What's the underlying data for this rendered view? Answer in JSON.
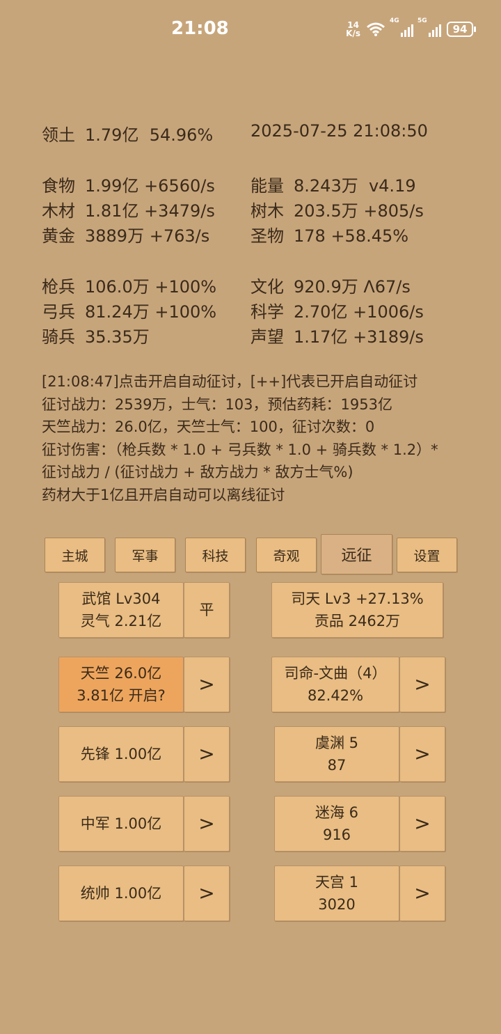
{
  "status": {
    "time": "21:08",
    "net_speed_value": "14",
    "net_speed_unit": "K/s",
    "sig1_label": "4G",
    "sig2_label": "5G",
    "battery": "94"
  },
  "stats": {
    "territory": {
      "k": "领土",
      "v": "1.79亿  54.96%"
    },
    "datetime": "2025-07-25 21:08:50",
    "food": {
      "k": "食物",
      "v": "1.99亿 +6560/s"
    },
    "energy": {
      "k": "能量",
      "v": "8.243万  v4.19"
    },
    "wood": {
      "k": "木材",
      "v": "1.81亿 +3479/s"
    },
    "tree": {
      "k": "树木",
      "v": "203.5万 +805/s"
    },
    "gold": {
      "k": "黄金",
      "v": "3889万 +763/s"
    },
    "relic": {
      "k": "圣物",
      "v": "178 +58.45%"
    },
    "spear": {
      "k": "枪兵",
      "v": "106.0万 +100%"
    },
    "culture": {
      "k": "文化",
      "v": "920.9万 Λ67/s"
    },
    "archer": {
      "k": "弓兵",
      "v": "81.24万 +100%"
    },
    "science": {
      "k": "科学",
      "v": "2.70亿 +1006/s"
    },
    "cavalry": {
      "k": "骑兵",
      "v": "35.35万"
    },
    "prestige": {
      "k": "声望",
      "v": "1.17亿 +3189/s"
    }
  },
  "log": [
    "[21:08:47]点击开启自动征讨，[++]代表已开启自动征讨",
    "征讨战力：2539万，士气：103，预估药耗：1953亿",
    "天竺战力：26.0亿，天竺士气：100，征讨次数：0",
    "征讨伤害：（枪兵数 * 1.0 + 弓兵数 * 1.0 + 骑兵数 * 1.2）*",
    "征讨战力 / (征讨战力 + 敌方战力 * 敌方士气%)",
    "药材大于1亿且开启自动可以离线征讨"
  ],
  "tabs": [
    "主城",
    "军事",
    "科技",
    "奇观",
    "远征",
    "设置"
  ],
  "active_tab": "远征",
  "panels": {
    "wuguan": {
      "l1": "武馆 Lv304",
      "l2": "灵气 2.21亿"
    },
    "ping": "平",
    "sitian": {
      "l1": "司天 Lv3 +27.13%",
      "l2": "贡品 2462万"
    },
    "tianzhu": {
      "l1": "天竺  26.0亿",
      "l2": "3.81亿 开启?"
    },
    "siming": {
      "l1": "司命-文曲（4）",
      "l2": "82.42%"
    },
    "xianfeng": "先锋  1.00亿",
    "yuyuan": {
      "l1": "虞渊  5",
      "l2": "87"
    },
    "zhongjun": "中军  1.00亿",
    "mihai": {
      "l1": "迷海  6",
      "l2": "916"
    },
    "tongshuai": "统帅  1.00亿",
    "tiangong": {
      "l1": "天宫  1",
      "l2": "3020"
    },
    "arrow": ">"
  },
  "colors": {
    "background": "#c7a57b",
    "button": "#e9bd83",
    "highlight": "#eda55d"
  }
}
